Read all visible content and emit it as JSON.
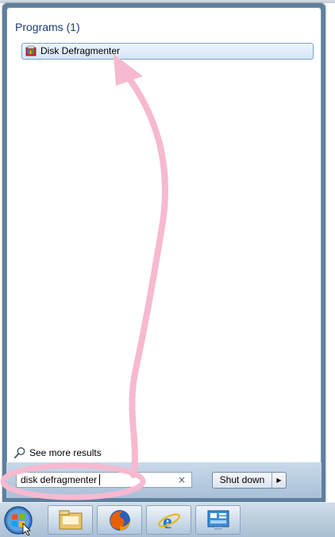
{
  "start_menu": {
    "section_heading": "Programs (1)",
    "results": [
      {
        "label": "Disk Defragmenter",
        "icon": "disk-defragmenter-icon"
      }
    ],
    "see_more_label": "See more results",
    "search": {
      "value": "disk defragmenter",
      "clear_symbol": "×"
    },
    "shutdown": {
      "label": "Shut down",
      "arrow": "▶"
    }
  },
  "taskbar": {
    "items": [
      {
        "name": "start-orb",
        "icon": "windows-orb-icon"
      },
      {
        "name": "windows-explorer",
        "icon": "folder-icon"
      },
      {
        "name": "firefox",
        "icon": "firefox-icon"
      },
      {
        "name": "internet-explorer",
        "icon": "internet-explorer-icon"
      },
      {
        "name": "control-panel",
        "icon": "control-panel-icon"
      }
    ]
  },
  "colors": {
    "heading": "#1e3c75",
    "highlight_annotation": "#f7b9d0",
    "selected_item": "#d4e5f8"
  }
}
